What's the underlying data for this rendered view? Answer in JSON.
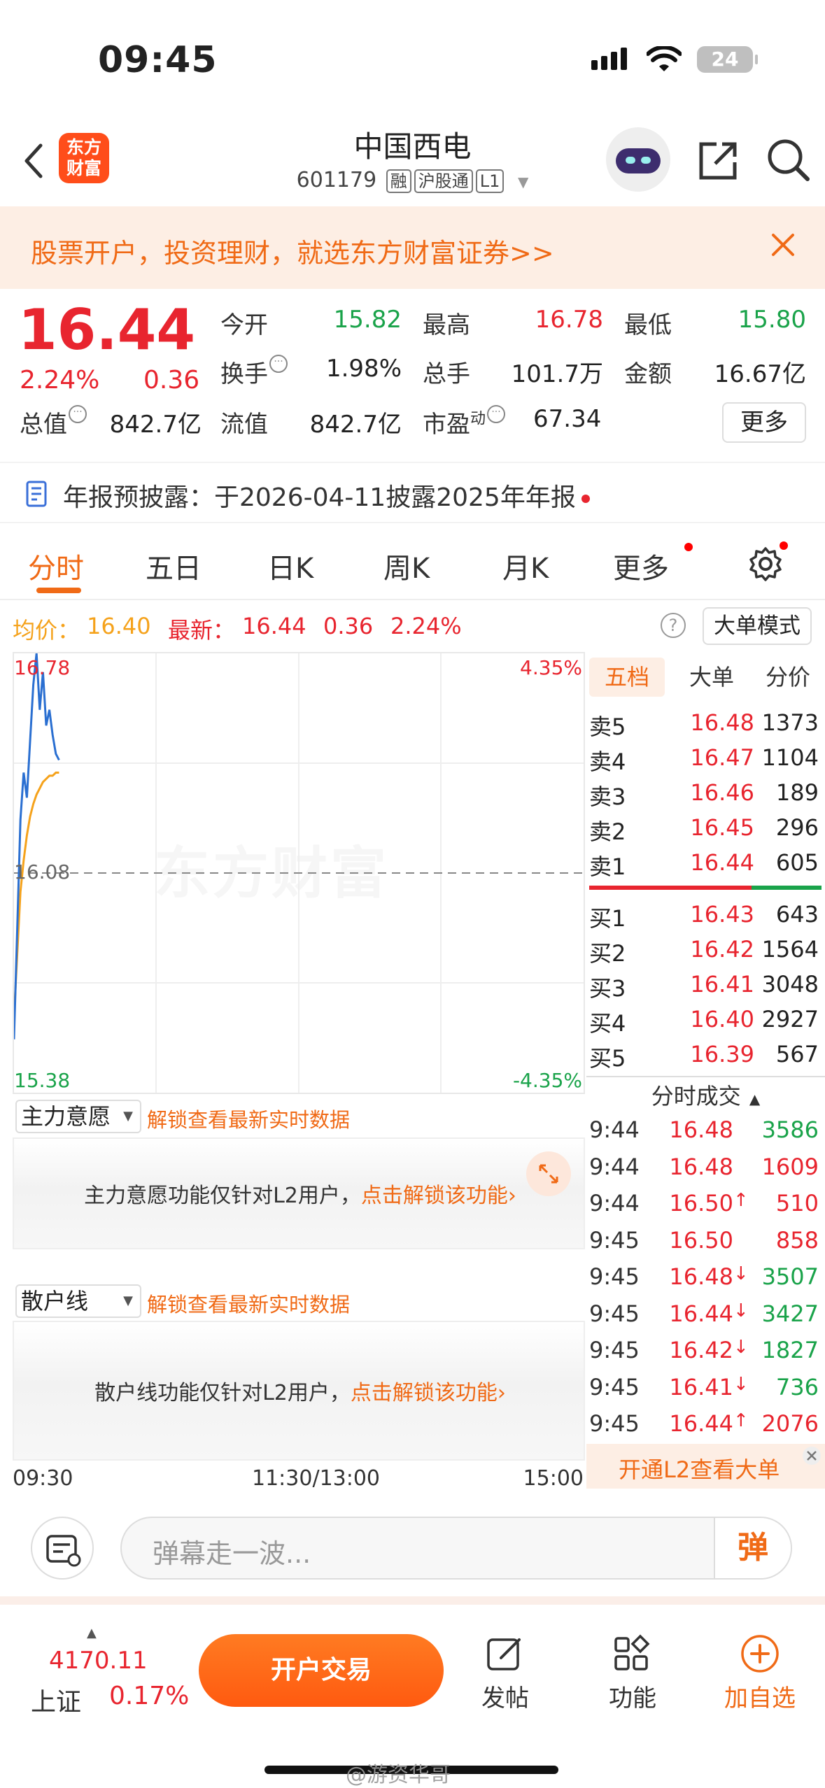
{
  "status": {
    "time": "09:45",
    "battery": "24"
  },
  "header": {
    "logo_line1": "东方",
    "logo_line2": "财富",
    "title": "中国西电",
    "code": "601179",
    "tags": [
      "融",
      "沪股通",
      "L1"
    ]
  },
  "banner": {
    "text": "股票开户，投资理财，就选东方财富证券>>"
  },
  "quote": {
    "price": "16.44",
    "pct": "2.24%",
    "change": "0.36",
    "open_label": "今开",
    "open": "15.82",
    "high_label": "最高",
    "high": "16.78",
    "low_label": "最低",
    "low": "15.80",
    "turnover_label": "换手",
    "turnover": "1.98%",
    "volume_label": "总手",
    "volume": "101.7万",
    "amount_label": "金额",
    "amount": "16.67亿",
    "mktcap_label": "总值",
    "mktcap": "842.7亿",
    "float_label": "流值",
    "float": "842.7亿",
    "pe_label": "市盈",
    "pe_sup": "动",
    "pe": "67.34",
    "more": "更多"
  },
  "notice": {
    "text": "年报预披露：于2026-04-11披露2025年年报"
  },
  "tabs": [
    "分时",
    "五日",
    "日K",
    "周K",
    "月K",
    "更多"
  ],
  "infoline": {
    "avg_label": "均价：",
    "avg": "16.40",
    "latest_label": "最新：",
    "latest": "16.44",
    "chg": "0.36",
    "pct": "2.24%",
    "help": "?",
    "mode": "大单模式"
  },
  "chart_data": {
    "type": "line",
    "ymax_label": "16.78",
    "ymin_label": "15.38",
    "ymax_pct": "4.35%",
    "ymin_pct": "-4.35%",
    "prev_close_label": "16.08",
    "prev_close": 16.08,
    "ylim": [
      15.38,
      16.78
    ],
    "watermark": "东方财富",
    "price_series": [
      15.55,
      15.9,
      16.25,
      16.4,
      16.32,
      16.5,
      16.68,
      16.78,
      16.6,
      16.72,
      16.55,
      16.6,
      16.52,
      16.46,
      16.44
    ],
    "avg_series": [
      15.62,
      15.82,
      16.02,
      16.12,
      16.2,
      16.26,
      16.3,
      16.33,
      16.35,
      16.37,
      16.38,
      16.39,
      16.39,
      16.4,
      16.4
    ]
  },
  "book": {
    "tabs": [
      "五档",
      "大单",
      "分价"
    ],
    "asks": [
      {
        "label": "卖5",
        "price": "16.48",
        "vol": "1373"
      },
      {
        "label": "卖4",
        "price": "16.47",
        "vol": "1104"
      },
      {
        "label": "卖3",
        "price": "16.46",
        "vol": "189"
      },
      {
        "label": "卖2",
        "price": "16.45",
        "vol": "296"
      },
      {
        "label": "卖1",
        "price": "16.44",
        "vol": "605"
      }
    ],
    "bids": [
      {
        "label": "买1",
        "price": "16.43",
        "vol": "643"
      },
      {
        "label": "买2",
        "price": "16.42",
        "vol": "1564"
      },
      {
        "label": "买3",
        "price": "16.41",
        "vol": "3048"
      },
      {
        "label": "买4",
        "price": "16.40",
        "vol": "2927"
      },
      {
        "label": "买5",
        "price": "16.39",
        "vol": "567"
      }
    ],
    "ticks_title": "分时成交",
    "ticks": [
      {
        "time": "9:44",
        "price": "16.48",
        "arrow": "",
        "vol": "3586",
        "dir": "buy"
      },
      {
        "time": "9:44",
        "price": "16.48",
        "arrow": "",
        "vol": "1609",
        "dir": "sell"
      },
      {
        "time": "9:44",
        "price": "16.50",
        "arrow": "↑",
        "vol": "510",
        "dir": "sell"
      },
      {
        "time": "9:45",
        "price": "16.50",
        "arrow": "",
        "vol": "858",
        "dir": "sell"
      },
      {
        "time": "9:45",
        "price": "16.48",
        "arrow": "↓",
        "vol": "3507",
        "dir": "buy"
      },
      {
        "time": "9:45",
        "price": "16.44",
        "arrow": "↓",
        "vol": "3427",
        "dir": "buy"
      },
      {
        "time": "9:45",
        "price": "16.42",
        "arrow": "↓",
        "vol": "1827",
        "dir": "buy"
      },
      {
        "time": "9:45",
        "price": "16.41",
        "arrow": "↓",
        "vol": "736",
        "dir": "buy"
      },
      {
        "time": "9:45",
        "price": "16.44",
        "arrow": "↑",
        "vol": "2076",
        "dir": "sell"
      }
    ],
    "l2_banner": "开通L2查看大单"
  },
  "panel1": {
    "select": "主力意愿",
    "unlock": "解锁查看最新实时数据",
    "msg_prefix": "主力意愿功能仅针对L2用户，",
    "msg_link": "点击解锁该功能"
  },
  "panel2": {
    "select": "散户线",
    "unlock": "解锁查看最新实时数据",
    "msg_prefix": "散户线功能仅针对L2用户，",
    "msg_link": "点击解锁该功能"
  },
  "timeline": {
    "start": "09:30",
    "mid": "11:30/13:00",
    "end": "15:00"
  },
  "comment": {
    "placeholder": "弹幕走一波...",
    "danmu": "弹"
  },
  "bottom": {
    "index_value": "4170.11",
    "index_name": "上证",
    "index_pct": "0.17%",
    "trade": "开户交易",
    "post": "发帖",
    "func": "功能",
    "add": "加自选",
    "watermark": "@游资华哥"
  },
  "colors": {
    "red": "#e8252f",
    "green": "#1aa34a",
    "orange": "#f06a16",
    "price_line": "#2a6fd1",
    "avg_line": "#f5a21b"
  }
}
